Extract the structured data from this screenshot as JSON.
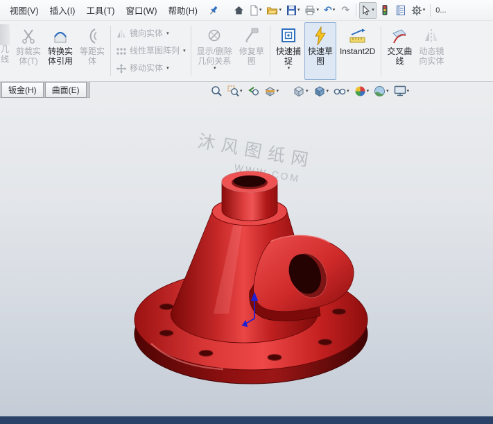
{
  "menubar": {
    "items": [
      {
        "label": "视图(V)"
      },
      {
        "label": "插入(I)"
      },
      {
        "label": "工具(T)"
      },
      {
        "label": "窗口(W)"
      },
      {
        "label": "帮助(H)"
      }
    ],
    "overflow_label": "0..."
  },
  "ribbon": {
    "clipped": {
      "line1": "几",
      "line2": "线"
    },
    "trim": {
      "line1": "剪裁实",
      "line2": "体(T)"
    },
    "convert": {
      "line1": "转换实",
      "line2": "体引用"
    },
    "offset": {
      "line1": "等距实",
      "line2": "体"
    },
    "stack": [
      {
        "label": "镜向实体"
      },
      {
        "label": "线性草图阵列"
      },
      {
        "label": "移动实体"
      }
    ],
    "display_relations": {
      "line1": "显示/删除",
      "line2": "几何关系"
    },
    "repair": {
      "line1": "修复草",
      "line2": "图"
    },
    "quick_snap": {
      "line1": "快速捕",
      "line2": "捉"
    },
    "quick_sketch": {
      "line1": "快速草",
      "line2": "图"
    },
    "instant2d": {
      "label": "Instant2D"
    },
    "intersection_curve": {
      "line1": "交叉曲",
      "line2": "线"
    },
    "dynamic_mirror": {
      "line1": "动态镜",
      "line2": "向实体"
    }
  },
  "tabs": [
    {
      "label": "钣金(H)"
    },
    {
      "label": "曲面(E)"
    }
  ],
  "headsup": {
    "icons": [
      "zoom-fit",
      "zoom-area",
      "previous-view",
      "section-view",
      "view-orientation",
      "display-style",
      "hide-show-items",
      "edit-appearance",
      "apply-scene",
      "view-settings"
    ]
  },
  "watermark": {
    "line1": "沐风图纸网",
    "line2": "WWW.COM"
  },
  "icons": {
    "dropdown_caret": "▾",
    "undo_glyph": "↶",
    "redo_glyph": "↷"
  },
  "colors": {
    "model_red": "#cc1515",
    "selection_blue": "#dde8f4",
    "viewport_top": "#ebedef",
    "viewport_bottom": "#c4ccd7",
    "statusbar": "#2a4168"
  }
}
